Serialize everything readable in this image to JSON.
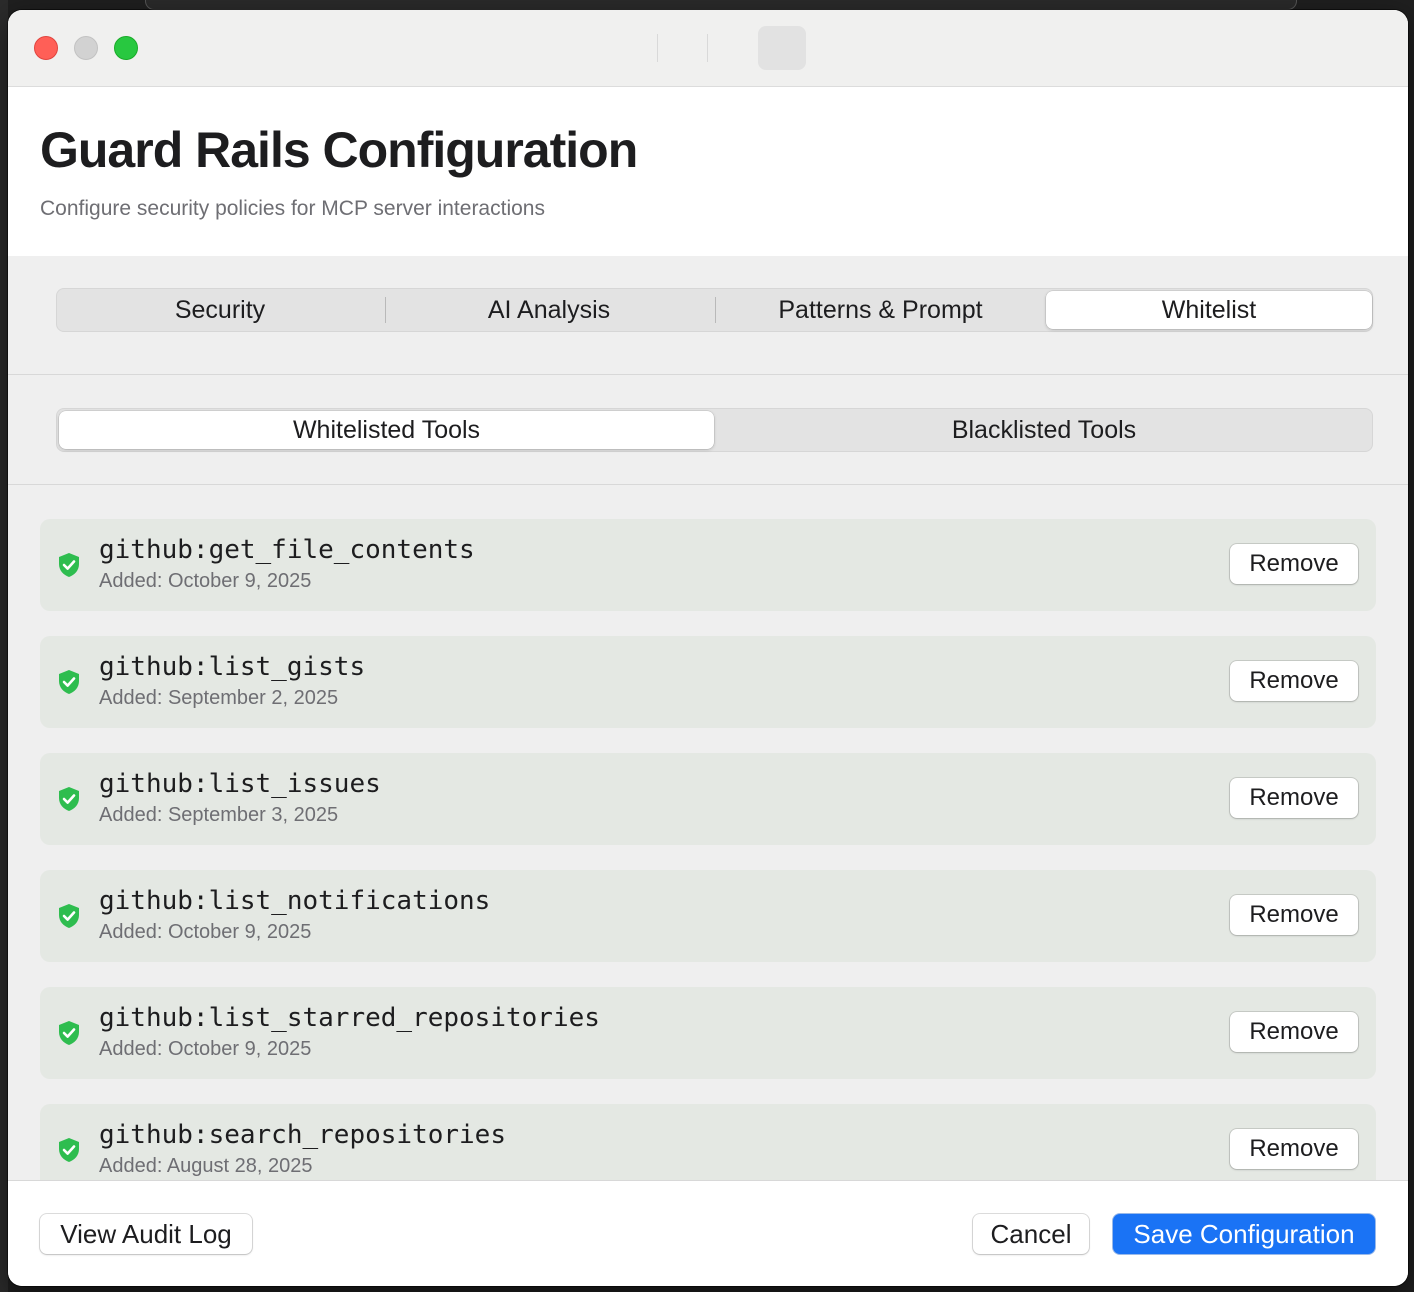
{
  "window": {
    "title": "Guard Rails Configuration",
    "subtitle": "Configure security policies for MCP server interactions"
  },
  "main_tabs": [
    {
      "label": "Security",
      "active": false
    },
    {
      "label": "AI Analysis",
      "active": false
    },
    {
      "label": "Patterns & Prompt",
      "active": false
    },
    {
      "label": "Whitelist",
      "active": true
    }
  ],
  "sub_tabs": [
    {
      "label": "Whitelisted Tools",
      "active": true
    },
    {
      "label": "Blacklisted Tools",
      "active": false
    }
  ],
  "tools": [
    {
      "name": "github:get_file_contents",
      "added": "Added: October 9, 2025",
      "action": "Remove",
      "icon": "shield-check-icon"
    },
    {
      "name": "github:list_gists",
      "added": "Added: September 2, 2025",
      "action": "Remove",
      "icon": "shield-check-icon"
    },
    {
      "name": "github:list_issues",
      "added": "Added: September 3, 2025",
      "action": "Remove",
      "icon": "shield-check-icon"
    },
    {
      "name": "github:list_notifications",
      "added": "Added: October 9, 2025",
      "action": "Remove",
      "icon": "shield-check-icon"
    },
    {
      "name": "github:list_starred_repositories",
      "added": "Added: October 9, 2025",
      "action": "Remove",
      "icon": "shield-check-icon"
    },
    {
      "name": "github:search_repositories",
      "added": "Added: August 28, 2025",
      "action": "Remove",
      "icon": "shield-check-icon"
    }
  ],
  "footer": {
    "audit_label": "View Audit Log",
    "cancel_label": "Cancel",
    "save_label": "Save Configuration"
  },
  "colors": {
    "accent": "#1a73f5",
    "shield": "#2ebd4f",
    "row_background": "#e4e8e3"
  }
}
